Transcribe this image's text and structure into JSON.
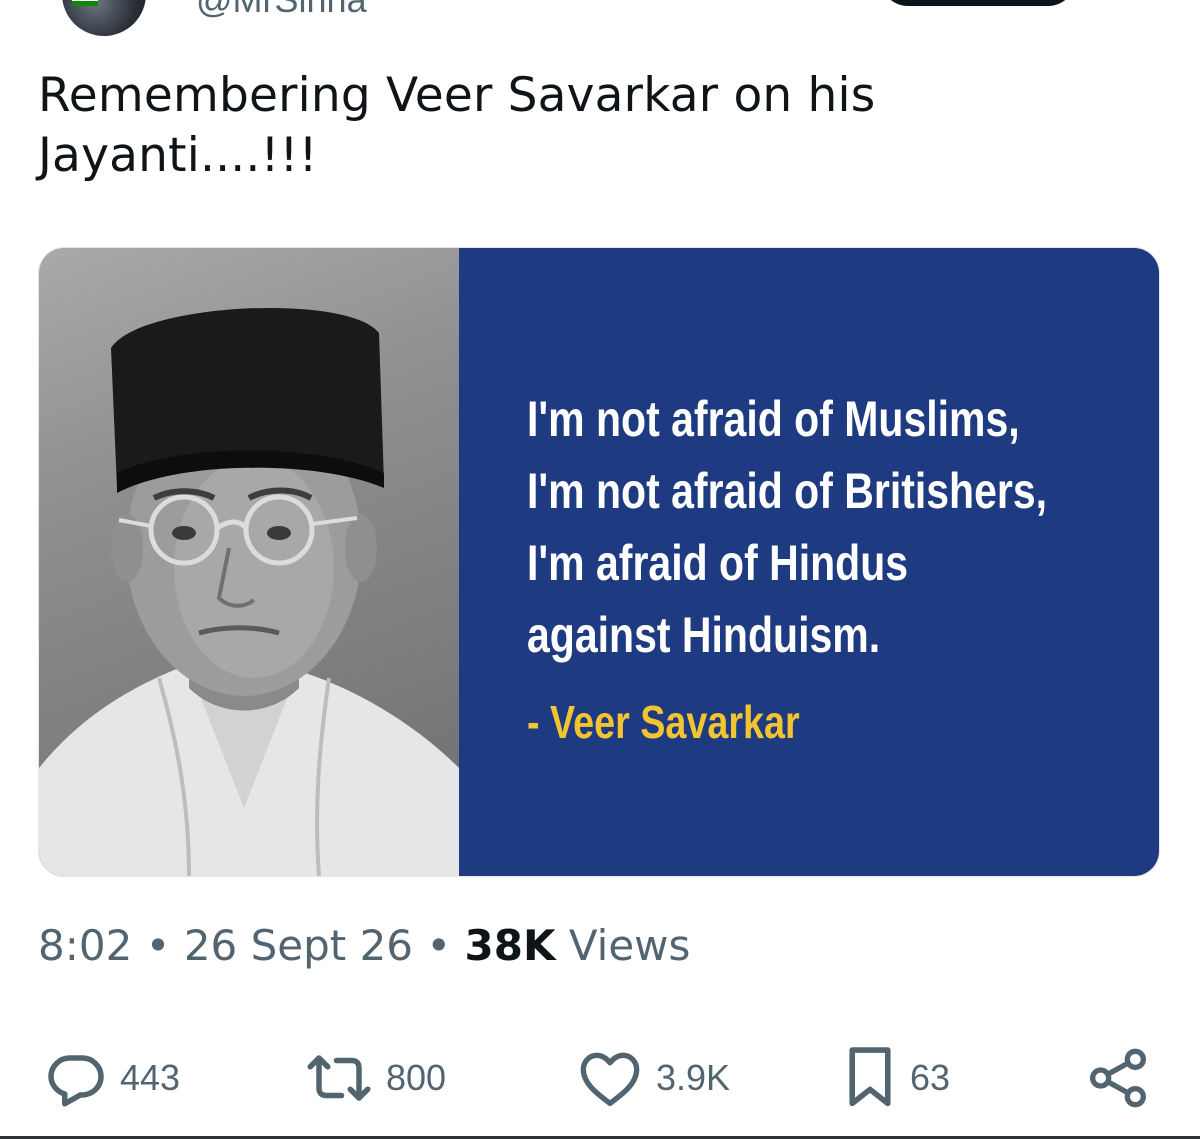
{
  "tweet": {
    "handle": "@MrSinha",
    "text": "Remembering Veer Savarkar on his Jayanti....!!!",
    "media": {
      "quote_lines": [
        "I'm not afraid of Muslims,",
        "I'm not afraid of Britishers,",
        "I'm afraid of Hindus",
        "against Hinduism."
      ],
      "author": "- Veer Savarkar",
      "panel_color": "#1e3a80",
      "author_color": "#f2c530"
    },
    "meta": {
      "time": "8:02",
      "sep1": " • ",
      "date": "26 Sept 26",
      "sep2": " • ",
      "views_count": "38K",
      "views_label": " Views"
    },
    "actions": {
      "replies": "443",
      "reposts": "800",
      "likes": "3.9K",
      "bookmarks": "63"
    },
    "icons": [
      "reply-icon",
      "repost-icon",
      "like-icon",
      "bookmark-icon",
      "share-icon"
    ]
  }
}
